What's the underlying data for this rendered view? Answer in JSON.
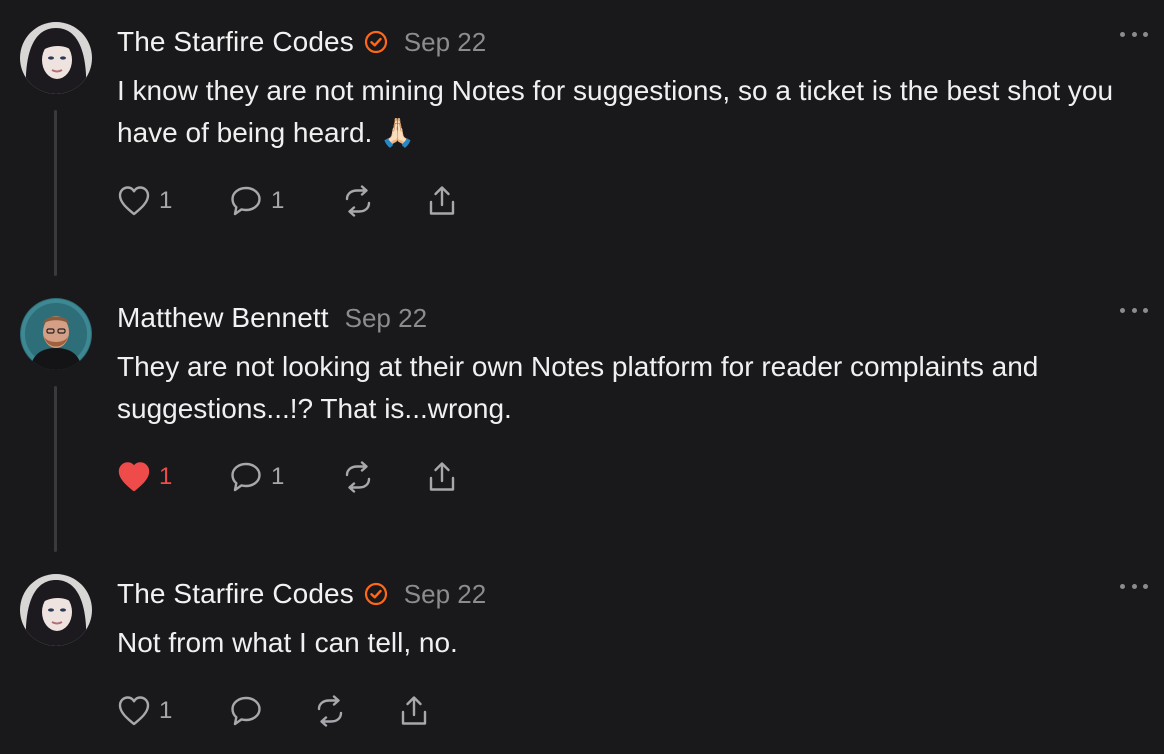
{
  "notes": [
    {
      "author": "The Starfire Codes",
      "verified": true,
      "date": "Sep 22",
      "text": "I know they are not mining Notes for suggestions, so a ticket is the best shot you have of being heard. 🙏🏻",
      "likes": "1",
      "liked": false,
      "comments": "1"
    },
    {
      "author": "Matthew Bennett",
      "verified": false,
      "date": "Sep 22",
      "text": "They are not looking at their own Notes platform for reader complaints and suggestions...!? That is...wrong.",
      "likes": "1",
      "liked": true,
      "comments": "1"
    },
    {
      "author": "The Starfire Codes",
      "verified": true,
      "date": "Sep 22",
      "text": "Not from what I can tell, no.",
      "likes": "1",
      "liked": false,
      "comments": ""
    }
  ],
  "icons": {
    "like": "heart-icon",
    "comment": "speech-bubble-icon",
    "restack": "restack-icon",
    "share": "share-icon",
    "more": "more-options-icon",
    "verified": "verified-check-icon"
  },
  "colors": {
    "background": "#19191b",
    "accent": "#ff6719",
    "liked": "#ef4b4b",
    "muted": "#8c8c90"
  }
}
